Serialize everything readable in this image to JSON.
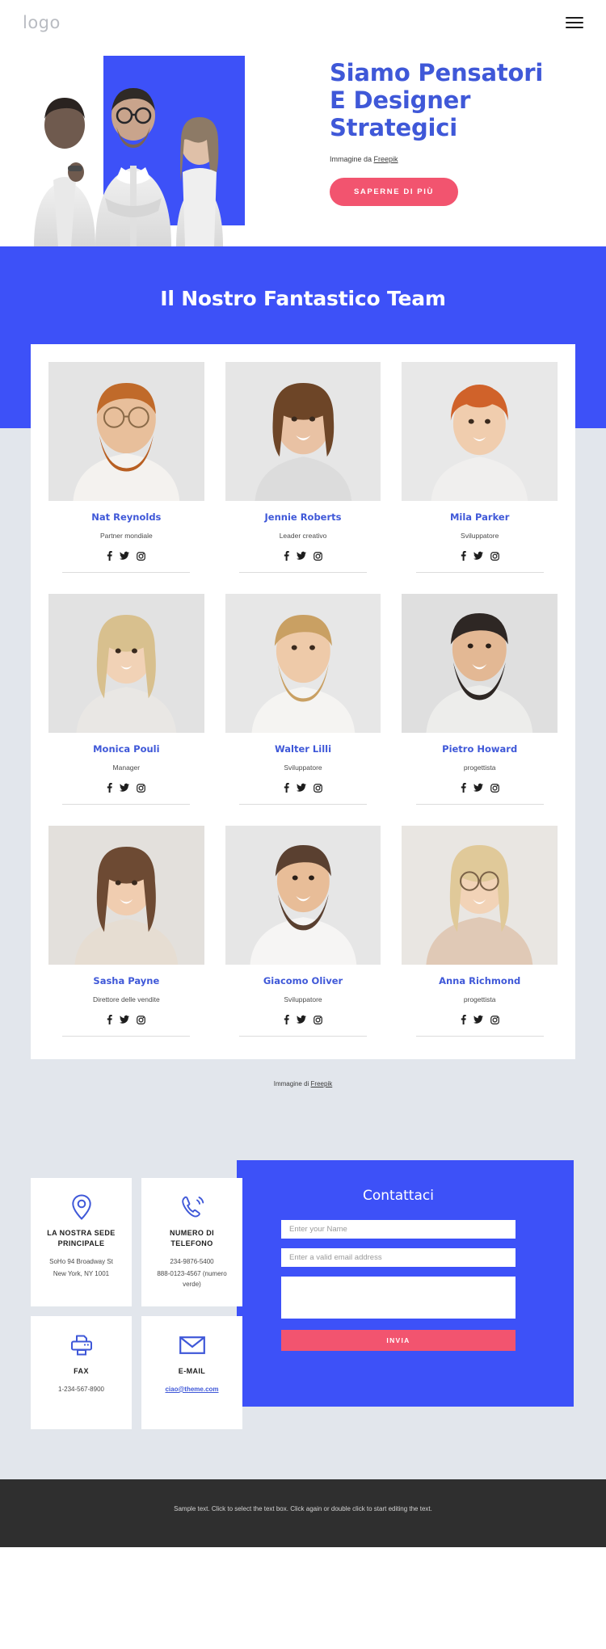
{
  "header": {
    "logo": "logo",
    "menu_icon": "hamburger-icon"
  },
  "hero": {
    "title_lines": [
      "Siamo Pensatori",
      "E Designer",
      "Strategici"
    ],
    "credit_prefix": "Immagine da ",
    "credit_link": "Freepik",
    "button_label": "SAPERNE DI PIÙ",
    "accent_blue": "#3d51f8",
    "accent_pink": "#f2546f"
  },
  "team": {
    "title": "Il Nostro Fantastico Team",
    "credit_prefix": "Immagine di ",
    "credit_link": "Freepik",
    "social": [
      "facebook-icon",
      "twitter-icon",
      "instagram-icon"
    ],
    "members": [
      {
        "name": "Nat Reynolds",
        "role": "Partner mondiale"
      },
      {
        "name": "Jennie Roberts",
        "role": "Leader creativo"
      },
      {
        "name": "Mila Parker",
        "role": "Sviluppatore"
      },
      {
        "name": "Monica Pouli",
        "role": "Manager"
      },
      {
        "name": "Walter Lilli",
        "role": "Sviluppatore"
      },
      {
        "name": "Pietro Howard",
        "role": "progettista"
      },
      {
        "name": "Sasha Payne",
        "role": "Direttore delle vendite"
      },
      {
        "name": "Giacomo Oliver",
        "role": "Sviluppatore"
      },
      {
        "name": "Anna Richmond",
        "role": "progettista"
      }
    ]
  },
  "contact": {
    "cards": [
      {
        "icon": "location-pin-icon",
        "title": "LA NOSTRA SEDE PRINCIPALE",
        "lines": [
          "SoHo 94 Broadway St",
          "New York, NY 1001"
        ]
      },
      {
        "icon": "phone-icon",
        "title": "NUMERO DI TELEFONO",
        "lines": [
          "234-9876-5400",
          "888-0123-4567 (numero verde)"
        ]
      },
      {
        "icon": "printer-icon",
        "title": "FAX",
        "lines": [
          "1-234-567-8900"
        ]
      },
      {
        "icon": "envelope-icon",
        "title": "E-MAIL",
        "lines": [],
        "email": "ciao@theme.com"
      }
    ],
    "form": {
      "title": "Contattaci",
      "name_placeholder": "Enter your Name",
      "name_value": "",
      "email_placeholder": "Enter a valid email address",
      "email_value": "",
      "message_placeholder": "",
      "message_value": "",
      "submit_label": "INVIA"
    }
  },
  "footer": {
    "text": "Sample text. Click to select the text box. Click again or double click to start editing the text."
  }
}
